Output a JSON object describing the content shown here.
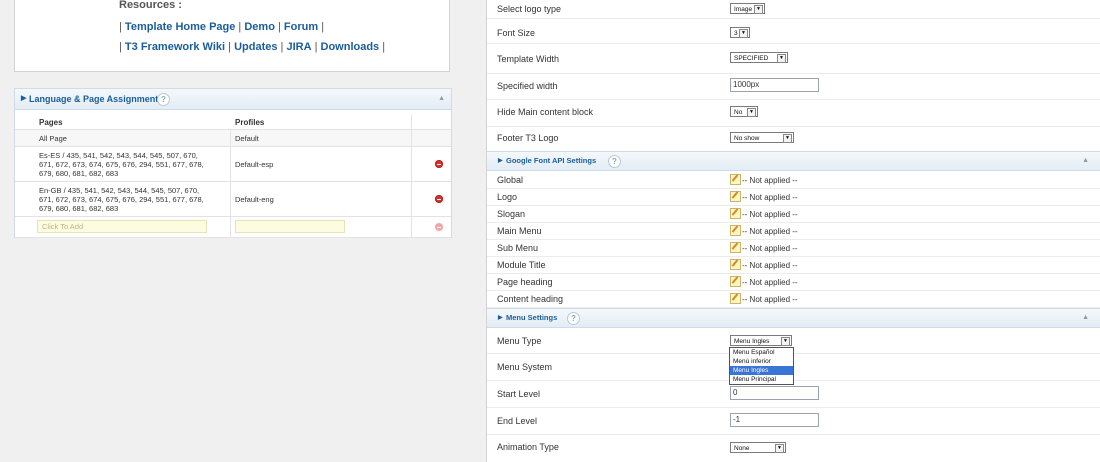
{
  "resources": {
    "title": "Resources :",
    "line1": {
      "pre": "| ",
      "links": [
        "Template Home Page",
        "Demo",
        "Forum"
      ],
      "sep": " | ",
      "post": " |"
    },
    "line2": {
      "pre": "| ",
      "links": [
        "T3 Framework Wiki",
        "Updates",
        "JIRA",
        "Downloads"
      ],
      "sep": " | ",
      "post": " |"
    }
  },
  "lang_panel": {
    "title": "Language & Page Assignments",
    "help": "?",
    "col_pages": "Pages",
    "col_profiles": "Profiles",
    "rows": [
      {
        "pages": "All Page",
        "profile": "Default"
      },
      {
        "pages": "Es-ES / 435, 541, 542, 543, 544, 545, 507, 670, 671, 672, 673, 674, 675, 676, 294, 551, 677, 678, 679, 680, 681, 682, 683",
        "profile": "Default-esp"
      },
      {
        "pages": "En-GB / 435, 541, 542, 543, 544, 545, 507, 670, 671, 672, 673, 674, 675, 676, 294, 551, 677, 678, 679, 680, 681, 682, 683",
        "profile": "Default-eng"
      }
    ],
    "add_placeholder": "Click To Add"
  },
  "settings": {
    "select_logo_type": {
      "label": "Select logo type",
      "value": "Image"
    },
    "font_size": {
      "label": "Font Size",
      "value": "3"
    },
    "template_width": {
      "label": "Template Width",
      "value": "SPECIFIED"
    },
    "specified_width": {
      "label": "Specified width",
      "value": "1000px"
    },
    "hide_main": {
      "label": "Hide Main content block",
      "value": "No"
    },
    "footer_logo": {
      "label": "Footer T3 Logo",
      "value": "No show"
    }
  },
  "google_font": {
    "title": "Google Font API Settings",
    "help": "?",
    "items": [
      {
        "label": "Global",
        "value": "-- Not applied --"
      },
      {
        "label": "Logo",
        "value": "-- Not applied --"
      },
      {
        "label": "Slogan",
        "value": "-- Not applied --"
      },
      {
        "label": "Main Menu",
        "value": "-- Not applied --"
      },
      {
        "label": "Sub Menu",
        "value": "-- Not applied --"
      },
      {
        "label": "Module Title",
        "value": "-- Not applied --"
      },
      {
        "label": "Page heading",
        "value": "-- Not applied --"
      },
      {
        "label": "Content heading",
        "value": "-- Not applied --"
      }
    ]
  },
  "menu_settings": {
    "title": "Menu Settings",
    "help": "?",
    "menu_type": {
      "label": "Menu Type",
      "value": "Menu Ingles"
    },
    "menu_type_options": [
      "Menu Español",
      "Menú inferior",
      "Menu Ingles",
      "Menu Principal"
    ],
    "menu_system": {
      "label": "Menu System"
    },
    "start_level": {
      "label": "Start Level",
      "value": "0"
    },
    "end_level": {
      "label": "End Level",
      "value": "-1"
    },
    "animation_type": {
      "label": "Animation Type",
      "value": "None"
    }
  }
}
